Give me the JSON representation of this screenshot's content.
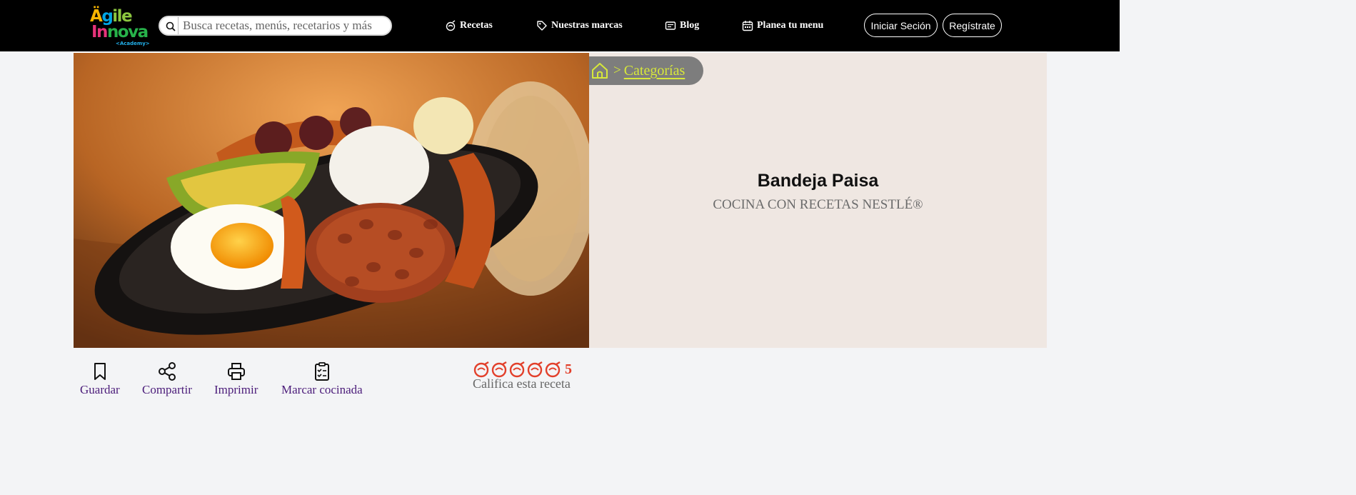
{
  "header": {
    "logo": {
      "line1": "Ägile",
      "line2": "Innova",
      "line3": "<Academy>"
    },
    "search": {
      "placeholder": "Busca recetas, menús, recetarios y más",
      "value": ""
    },
    "nav": [
      {
        "label": "Recetas",
        "icon": "chef-pot-icon"
      },
      {
        "label": "Nuestras marcas",
        "icon": "tag-icon"
      },
      {
        "label": "Blog",
        "icon": "blog-icon"
      },
      {
        "label": "Planea tu menu",
        "icon": "calendar-icon"
      }
    ],
    "login_label": "Iniciar Seción",
    "register_label": "Regístrate"
  },
  "breadcrumb": {
    "separator": ">",
    "current": "Categorías"
  },
  "recipe": {
    "title": "Bandeja Paisa",
    "subtitle": "COCINA CON RECETAS NESTLÉ®"
  },
  "actions": [
    {
      "label": "Guardar",
      "icon": "bookmark-icon"
    },
    {
      "label": "Compartir",
      "icon": "share-icon"
    },
    {
      "label": "Imprimir",
      "icon": "printer-icon"
    },
    {
      "label": "Marcar cocinada",
      "icon": "clipboard-check-icon"
    }
  ],
  "rating": {
    "stars": 5,
    "value": "5",
    "label": "Califica esta receta"
  },
  "colors": {
    "header_bg": "#000000",
    "accent_lime": "#d7e83a",
    "action_purple": "#4b1c7a",
    "rating_red": "#e2402b",
    "hero_bg": "#efe7e2"
  }
}
